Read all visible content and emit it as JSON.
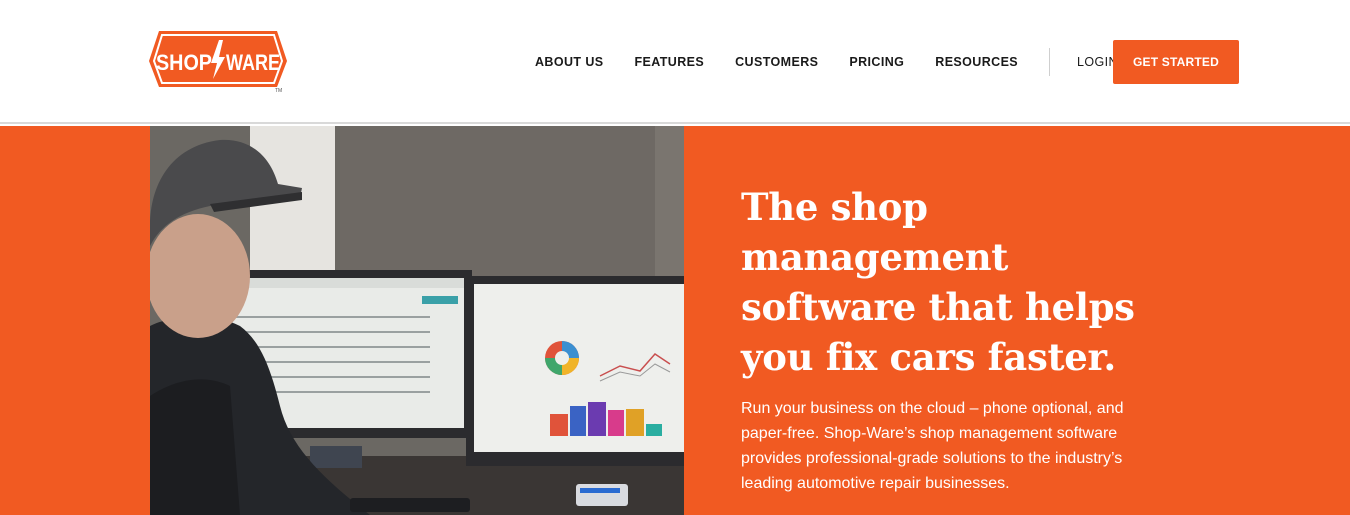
{
  "brand": {
    "name": "SHOP WARE",
    "logo_left": "SHOP",
    "logo_right": "WARE",
    "trademark": "TM",
    "accent_color": "#f15a22"
  },
  "nav": {
    "items": [
      {
        "label": "ABOUT US"
      },
      {
        "label": "FEATURES"
      },
      {
        "label": "CUSTOMERS"
      },
      {
        "label": "PRICING"
      },
      {
        "label": "RESOURCES"
      }
    ],
    "login_label": "LOGIN",
    "cta_label": "GET STARTED"
  },
  "hero": {
    "headline": "The shop management software that helps you fix cars faster.",
    "body": "Run your business on the cloud – phone optional, and paper-free. Shop-Ware’s shop management software provides professional-grade solutions to the industry’s leading automotive repair businesses.",
    "image_subject": "technician-at-dual-monitors-photo"
  }
}
